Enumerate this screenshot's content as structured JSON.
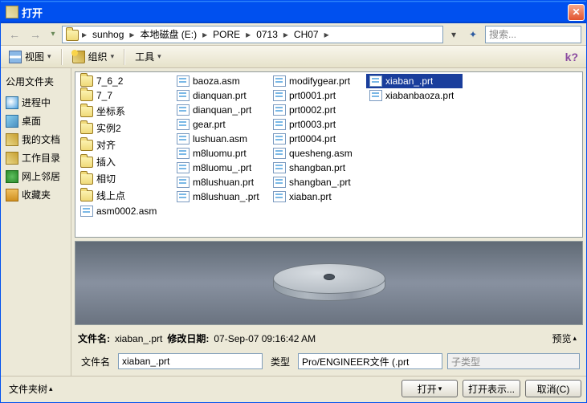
{
  "window": {
    "title": "打开"
  },
  "breadcrumb": [
    "sunhog",
    "本地磁盘 (E:)",
    "PORE",
    "0713",
    "CH07"
  ],
  "search": {
    "placeholder": "搜索..."
  },
  "toolbar": {
    "view": "视图",
    "organize": "组织",
    "tools": "工具"
  },
  "sidebar": {
    "title": "公用文件夹",
    "items": [
      {
        "label": "进程中"
      },
      {
        "label": "桌面"
      },
      {
        "label": "我的文档"
      },
      {
        "label": "工作目录"
      },
      {
        "label": "网上邻居"
      },
      {
        "label": "收藏夹"
      }
    ]
  },
  "files": {
    "col1": [
      {
        "name": "7_6_2",
        "type": "folder"
      },
      {
        "name": "7_7",
        "type": "folder"
      },
      {
        "name": "坐标系",
        "type": "folder"
      },
      {
        "name": "实例2",
        "type": "folder"
      },
      {
        "name": "对齐",
        "type": "folder"
      },
      {
        "name": "插入",
        "type": "folder"
      },
      {
        "name": "相切",
        "type": "folder"
      },
      {
        "name": "线上点",
        "type": "folder"
      },
      {
        "name": "asm0002.asm",
        "type": "file"
      }
    ],
    "col2": [
      {
        "name": "baoza.asm",
        "type": "file"
      },
      {
        "name": "dianquan.prt",
        "type": "file"
      },
      {
        "name": "dianquan_.prt",
        "type": "file"
      },
      {
        "name": "gear.prt",
        "type": "file"
      },
      {
        "name": "lushuan.asm",
        "type": "file"
      },
      {
        "name": "m8luomu.prt",
        "type": "file"
      },
      {
        "name": "m8luomu_.prt",
        "type": "file"
      },
      {
        "name": "m8lushuan.prt",
        "type": "file"
      },
      {
        "name": "m8lushuan_.prt",
        "type": "file"
      }
    ],
    "col3": [
      {
        "name": "modifygear.prt",
        "type": "file"
      },
      {
        "name": "prt0001.prt",
        "type": "file"
      },
      {
        "name": "prt0002.prt",
        "type": "file"
      },
      {
        "name": "prt0003.prt",
        "type": "file"
      },
      {
        "name": "prt0004.prt",
        "type": "file"
      },
      {
        "name": "quesheng.asm",
        "type": "file"
      },
      {
        "name": "shangban.prt",
        "type": "file"
      },
      {
        "name": "shangban_.prt",
        "type": "file"
      },
      {
        "name": "xiaban.prt",
        "type": "file"
      }
    ],
    "col4": [
      {
        "name": "xiaban_.prt",
        "type": "file",
        "selected": true
      },
      {
        "name": "xiabanbaoza.prt",
        "type": "file"
      }
    ]
  },
  "info": {
    "filename_label": "文件名:",
    "filename_value": "xiaban_.prt",
    "moddate_label": "修改日期:",
    "moddate_value": "07-Sep-07 09:16:42 AM",
    "preview": "预览"
  },
  "bottom": {
    "filename_label": "文件名",
    "filename_value": "xiaban_.prt",
    "type_label": "类型",
    "type_value": "Pro/ENGINEER文件 (.prt",
    "subtype": "子类型"
  },
  "footer": {
    "foldertree": "文件夹树",
    "open": "打开",
    "openrep": "打开表示...",
    "cancel": "取消(C)"
  }
}
